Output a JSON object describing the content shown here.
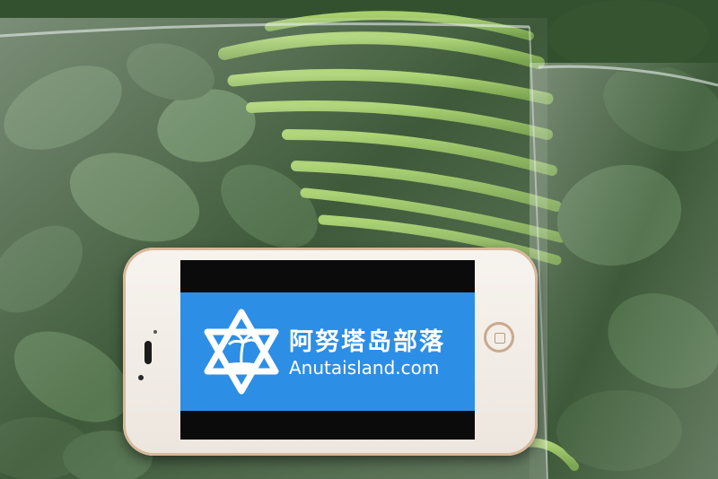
{
  "scene": {
    "description_colors": {
      "leaf_dark": "#2f4a2c",
      "leaf_mid": "#4c6b45",
      "stem": "#8fbf5a",
      "bag_highlight": "#dfe7e3"
    }
  },
  "phone": {
    "frame_color": "#d8b89a",
    "banner": {
      "background": "#2d8ee6",
      "brand_cn": "阿努塔岛部落",
      "brand_en": "Anutaisland.com",
      "logo_icon": "star-of-david-palm-island-icon"
    }
  }
}
